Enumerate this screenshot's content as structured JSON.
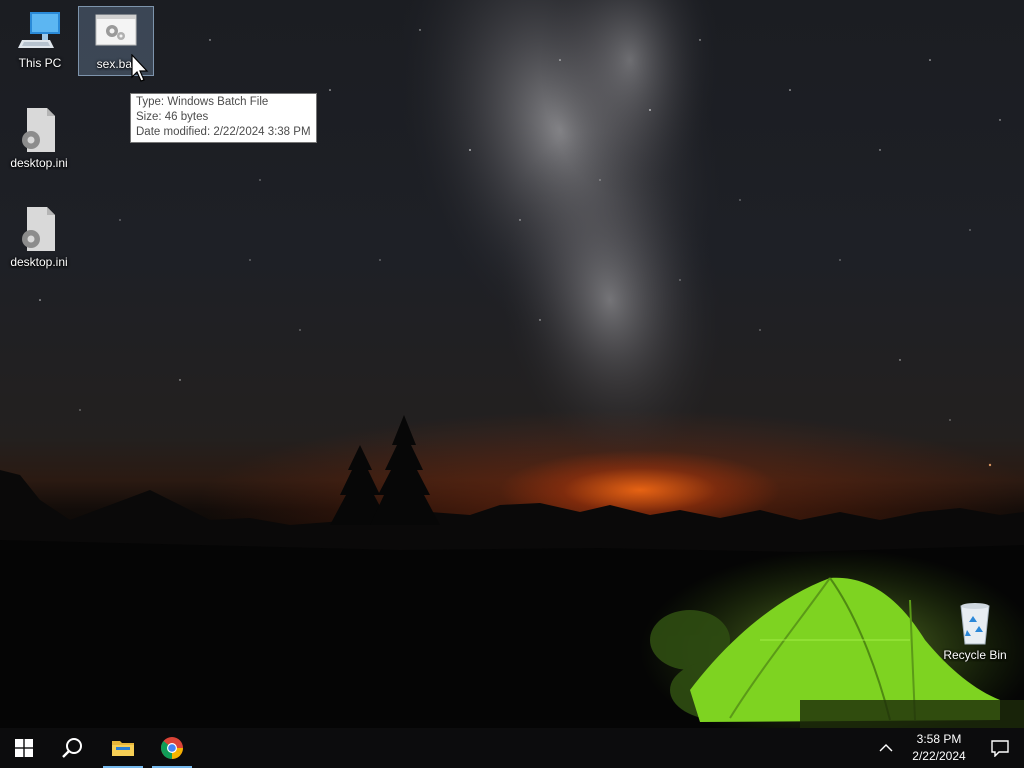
{
  "desktop": {
    "icons": [
      {
        "label": "This PC",
        "icon": "this-pc-icon"
      },
      {
        "label": "sex.bat",
        "icon": "batch-file-icon",
        "selected": true
      },
      {
        "label": "desktop.ini",
        "icon": "settings-file-icon"
      },
      {
        "label": "desktop.ini",
        "icon": "settings-file-icon"
      },
      {
        "label": "Recycle Bin",
        "icon": "recycle-bin-icon"
      }
    ],
    "tooltip": {
      "type": "Type: Windows Batch File",
      "size": "Size: 46 bytes",
      "modified": "Date modified: 2/22/2024 3:38 PM"
    }
  },
  "taskbar": {
    "start": "windows-start-icon",
    "search": "search-icon",
    "pinned": [
      {
        "name": "File Explorer",
        "icon": "folder-icon",
        "active": true
      },
      {
        "name": "Google Chrome",
        "icon": "chrome-icon",
        "active": true
      }
    ],
    "tray": {
      "chevron": "chevron-up-icon",
      "time": "3:58 PM",
      "date": "2/22/2024",
      "notifications": "action-center-icon"
    }
  },
  "colors": {
    "taskbar_bg": "#0c0c0d",
    "accent": "#76b9ed",
    "tent": "#7ed321",
    "horizon": "#ff6a14"
  }
}
